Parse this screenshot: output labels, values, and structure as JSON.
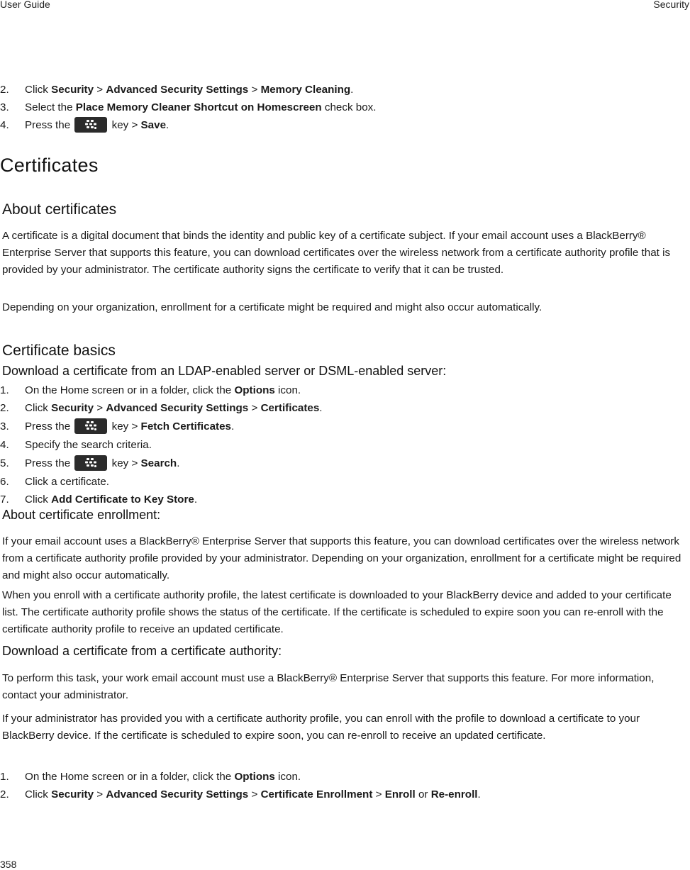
{
  "header": {
    "left": "User Guide",
    "right": "Security"
  },
  "footer": {
    "page_number": "358"
  },
  "top_steps": [
    {
      "num": "2.",
      "parts": [
        {
          "t": "Click ",
          "b": false
        },
        {
          "t": "Security",
          "b": true
        },
        {
          "t": " > ",
          "b": false
        },
        {
          "t": "Advanced Security Settings",
          "b": true
        },
        {
          "t": " > ",
          "b": false
        },
        {
          "t": "Memory Cleaning",
          "b": true
        },
        {
          "t": ".",
          "b": false
        }
      ]
    },
    {
      "num": "3.",
      "parts": [
        {
          "t": "Select the ",
          "b": false
        },
        {
          "t": "Place Memory Cleaner Shortcut on Homescreen",
          "b": true
        },
        {
          "t": " check box.",
          "b": false
        }
      ]
    },
    {
      "num": "4.",
      "parts": [
        {
          "t": "Press the ",
          "b": false
        },
        {
          "key": "menu-key"
        },
        {
          "t": " key > ",
          "b": false
        },
        {
          "t": "Save",
          "b": true
        },
        {
          "t": ".",
          "b": false
        }
      ]
    }
  ],
  "section_title": "Certificates",
  "about": {
    "title": "About certificates",
    "p1": "A certificate is a digital document that binds the identity and public key of a certificate subject. If your email account uses a BlackBerry® Enterprise Server that supports this feature, you can download certificates over the wireless network from a certificate authority profile that is provided by your administrator. The certificate authority signs the certificate to verify that it can be trusted.",
    "p2": "Depending on your organization, enrollment for a certificate might be required and might also occur automatically."
  },
  "basics": {
    "title": "Certificate basics",
    "ldap_title": "Download a certificate from an LDAP-enabled server or DSML-enabled server:",
    "ldap_steps": [
      {
        "num": "1.",
        "parts": [
          {
            "t": "On the Home screen or in a folder, click the ",
            "b": false
          },
          {
            "t": "Options",
            "b": true
          },
          {
            "t": " icon.",
            "b": false
          }
        ]
      },
      {
        "num": "2.",
        "parts": [
          {
            "t": "Click ",
            "b": false
          },
          {
            "t": "Security",
            "b": true
          },
          {
            "t": " > ",
            "b": false
          },
          {
            "t": "Advanced Security Settings",
            "b": true
          },
          {
            "t": " > ",
            "b": false
          },
          {
            "t": "Certificates",
            "b": true
          },
          {
            "t": ".",
            "b": false
          }
        ]
      },
      {
        "num": "3.",
        "parts": [
          {
            "t": "Press the ",
            "b": false
          },
          {
            "key": "menu-key"
          },
          {
            "t": " key > ",
            "b": false
          },
          {
            "t": "Fetch Certificates",
            "b": true
          },
          {
            "t": ".",
            "b": false
          }
        ]
      },
      {
        "num": "4.",
        "parts": [
          {
            "t": "Specify the search criteria.",
            "b": false
          }
        ]
      },
      {
        "num": "5.",
        "parts": [
          {
            "t": "Press the ",
            "b": false
          },
          {
            "key": "menu-key"
          },
          {
            "t": " key > ",
            "b": false
          },
          {
            "t": "Search",
            "b": true
          },
          {
            "t": ".",
            "b": false
          }
        ]
      },
      {
        "num": "6.",
        "parts": [
          {
            "t": "Click a certificate.",
            "b": false
          }
        ]
      },
      {
        "num": "7.",
        "parts": [
          {
            "t": "Click ",
            "b": false
          },
          {
            "t": "Add Certificate to Key Store",
            "b": true
          },
          {
            "t": ".",
            "b": false
          }
        ]
      }
    ],
    "enroll_title": "About certificate enrollment:",
    "enroll_p1": "If your email account uses a BlackBerry® Enterprise Server that supports this feature, you can download certificates over the wireless network from a certificate authority profile provided by your administrator. Depending on your organization, enrollment for a certificate might be required and might also occur automatically.",
    "enroll_p2": "When you enroll with a certificate authority profile, the latest certificate is downloaded to your BlackBerry device and added to your certificate list. The certificate authority profile shows the status of the certificate. If the certificate is scheduled to expire soon you can re-enroll with the certificate authority profile to receive an updated certificate.",
    "ca_title": "Download a certificate from a certificate authority:",
    "ca_p1": "To perform this task, your work email account must use a BlackBerry® Enterprise Server that supports this feature. For more information, contact your administrator.",
    "ca_p2": "If your administrator has provided you with a certificate authority profile, you can enroll with the profile to download a certificate to your BlackBerry device. If the certificate is scheduled to expire soon, you can re-enroll to receive an updated certificate.",
    "ca_steps": [
      {
        "num": "1.",
        "parts": [
          {
            "t": "On the Home screen or in a folder, click the ",
            "b": false
          },
          {
            "t": "Options",
            "b": true
          },
          {
            "t": " icon.",
            "b": false
          }
        ]
      },
      {
        "num": "2.",
        "parts": [
          {
            "t": "Click ",
            "b": false
          },
          {
            "t": "Security",
            "b": true
          },
          {
            "t": " > ",
            "b": false
          },
          {
            "t": "Advanced Security Settings",
            "b": true
          },
          {
            "t": " > ",
            "b": false
          },
          {
            "t": "Certificate Enrollment",
            "b": true
          },
          {
            "t": " > ",
            "b": false
          },
          {
            "t": "Enroll",
            "b": true
          },
          {
            "t": " or ",
            "b": false
          },
          {
            "t": "Re-enroll",
            "b": true
          },
          {
            "t": ".",
            "b": false
          }
        ]
      }
    ]
  }
}
